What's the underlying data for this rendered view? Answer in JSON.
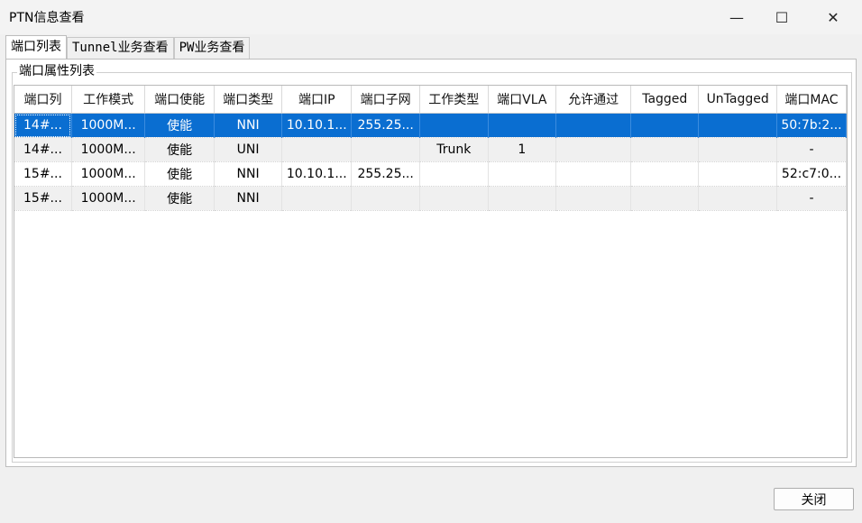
{
  "window": {
    "title": "PTN信息查看",
    "controls": {
      "minimize": "—",
      "maximize": "☐",
      "close": "✕"
    }
  },
  "tabs": [
    {
      "label": "端口列表",
      "active": true
    },
    {
      "label": "Tunnel业务查看",
      "active": false
    },
    {
      "label": "PW业务查看",
      "active": false
    }
  ],
  "group": {
    "label": "端口属性列表"
  },
  "table": {
    "columns": [
      "端口列",
      "工作模式",
      "端口使能",
      "端口类型",
      "端口IP",
      "端口子网",
      "工作类型",
      "端口VLA",
      "允许通过",
      "Tagged",
      "UnTagged",
      "端口MAC"
    ],
    "rows": [
      [
        "14#...",
        "1000M...",
        "使能",
        "NNI",
        "10.10.1...",
        "255.25...",
        "",
        "",
        "",
        "",
        "",
        "50:7b:2..."
      ],
      [
        "14#...",
        "1000M...",
        "使能",
        "UNI",
        "",
        "",
        "Trunk",
        "1",
        "",
        "",
        "",
        "-"
      ],
      [
        "15#...",
        "1000M...",
        "使能",
        "NNI",
        "10.10.1...",
        "255.25...",
        "",
        "",
        "",
        "",
        "",
        "52:c7:0..."
      ],
      [
        "15#...",
        "1000M...",
        "使能",
        "NNI",
        "",
        "",
        "",
        "",
        "",
        "",
        "",
        "-"
      ]
    ],
    "selected_row": 0
  },
  "footer": {
    "close_label": "关闭"
  }
}
